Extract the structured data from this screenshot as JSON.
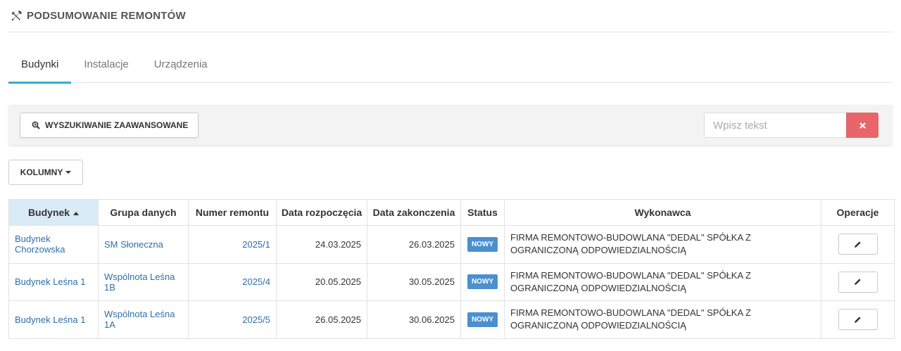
{
  "title": "PODSUMOWANIE REMONTÓW",
  "title_icon": "tools-icon",
  "tabs": [
    {
      "label": "Budynki",
      "active": true
    },
    {
      "label": "Instalacje",
      "active": false
    },
    {
      "label": "Urządzenia",
      "active": false
    }
  ],
  "search": {
    "advanced_label": "WYSZUKIWANIE ZAAWANSOWANE",
    "advanced_icon": "search-plus-icon",
    "placeholder": "Wpisz tekst",
    "value": "",
    "clear_icon": "close-icon"
  },
  "columns_button": "KOLUMNY",
  "table": {
    "headers": [
      "Budynek",
      "Grupa danych",
      "Numer remontu",
      "Data rozpoczęcia",
      "Data zakonczenia",
      "Status",
      "Wykonawca",
      "Operacje"
    ],
    "sorted_column": "Budynek",
    "rows": [
      {
        "budynek": "Budynek Chorzowska",
        "grupa": "SM Słoneczna",
        "numer": "2025/1",
        "start": "24.03.2025",
        "end": "26.03.2025",
        "status": "NOWY",
        "wykonawca": "FIRMA REMONTOWO-BUDOWLANA \"DEDAL\" SPÓŁKA Z OGRANICZONĄ ODPOWIEDZIALNOŚCIĄ"
      },
      {
        "budynek": "Budynek Leśna 1",
        "grupa": "Wspólnota Leśna 1B",
        "numer": "2025/4",
        "start": "20.05.2025",
        "end": "30.05.2025",
        "status": "NOWY",
        "wykonawca": "FIRMA REMONTOWO-BUDOWLANA \"DEDAL\" SPÓŁKA Z OGRANICZONĄ ODPOWIEDZIALNOŚCIĄ"
      },
      {
        "budynek": "Budynek Leśna 1",
        "grupa": "Wspólnota Leśna 1A",
        "numer": "2025/5",
        "start": "26.05.2025",
        "end": "30.06.2025",
        "status": "NOWY",
        "wykonawca": "FIRMA REMONTOWO-BUDOWLANA \"DEDAL\" SPÓŁKA Z OGRANICZONĄ ODPOWIEDZIALNOŚCIĄ"
      }
    ]
  },
  "colors": {
    "accent_tab": "#2eb0c8",
    "link": "#2f6ea8",
    "badge": "#4a90cf",
    "clear_button": "#e8666a",
    "sorted_header": "#d9ebf7"
  }
}
